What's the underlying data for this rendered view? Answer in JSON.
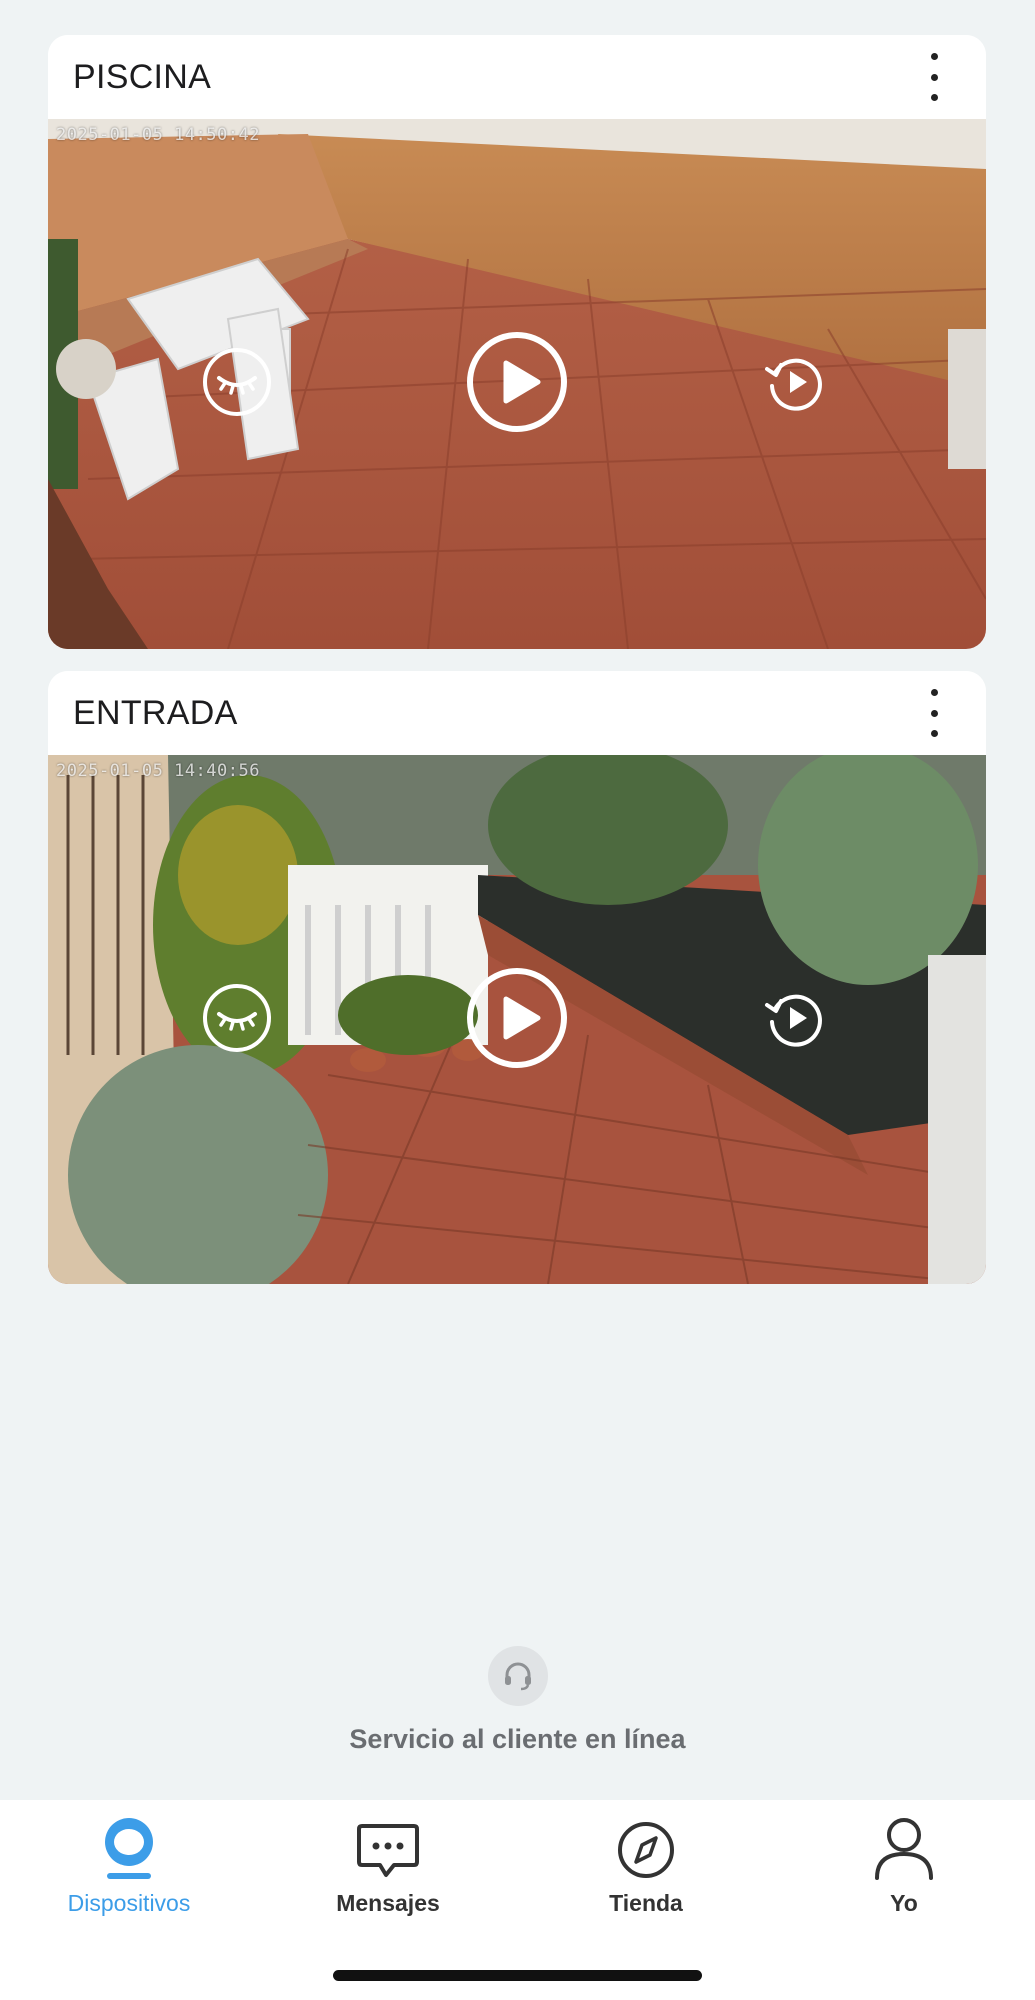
{
  "colors": {
    "background": "#eff3f4",
    "accent": "#3c9de8",
    "tab_inactive": "#333333",
    "service_text": "#6a6d71"
  },
  "cameras": [
    {
      "name": "PISCINA",
      "timestamp": "2025-01-05 14:50:42",
      "controls": {
        "privacy_icon": "closed-eye-icon",
        "play_icon": "play-icon",
        "playback_icon": "replay-icon"
      }
    },
    {
      "name": "ENTRADA",
      "timestamp": "2025-01-05 14:40:56",
      "controls": {
        "privacy_icon": "closed-eye-icon",
        "play_icon": "play-icon",
        "playback_icon": "replay-icon"
      }
    }
  ],
  "service": {
    "icon": "headset-icon",
    "label": "Servicio al cliente en línea"
  },
  "tabs": [
    {
      "label": "Dispositivos",
      "icon": "devices-icon",
      "active": true
    },
    {
      "label": "Mensajes",
      "icon": "message-icon",
      "active": false
    },
    {
      "label": "Tienda",
      "icon": "compass-icon",
      "active": false
    },
    {
      "label": "Yo",
      "icon": "person-icon",
      "active": false
    }
  ]
}
